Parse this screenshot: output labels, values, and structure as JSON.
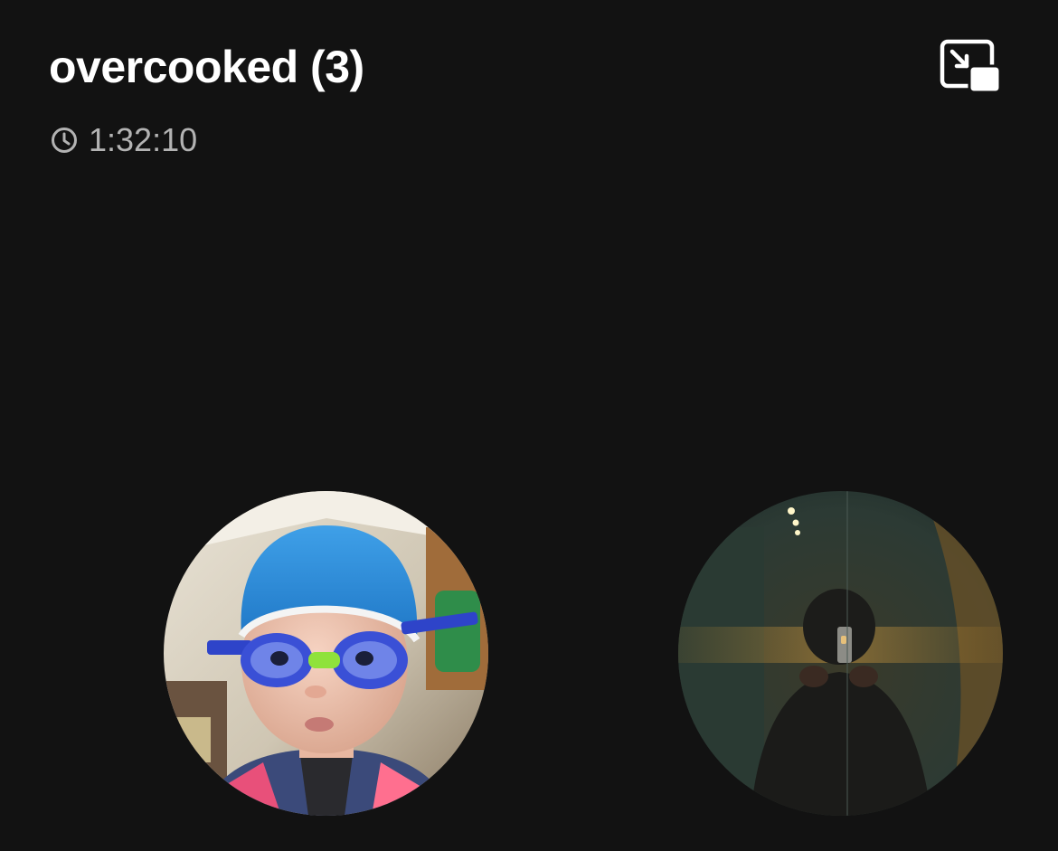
{
  "header": {
    "title": "overcooked (3)",
    "duration": "1:32:10",
    "duration_icon": "clock-icon",
    "pip_icon": "picture-in-picture-exit-icon"
  },
  "participants": [
    {
      "avatar": "participant-avatar-child-goggles"
    },
    {
      "avatar": "participant-avatar-mirror-selfie"
    }
  ],
  "colors": {
    "background": "#121212",
    "text_primary": "#ffffff",
    "text_secondary": "#b3b3b3"
  }
}
